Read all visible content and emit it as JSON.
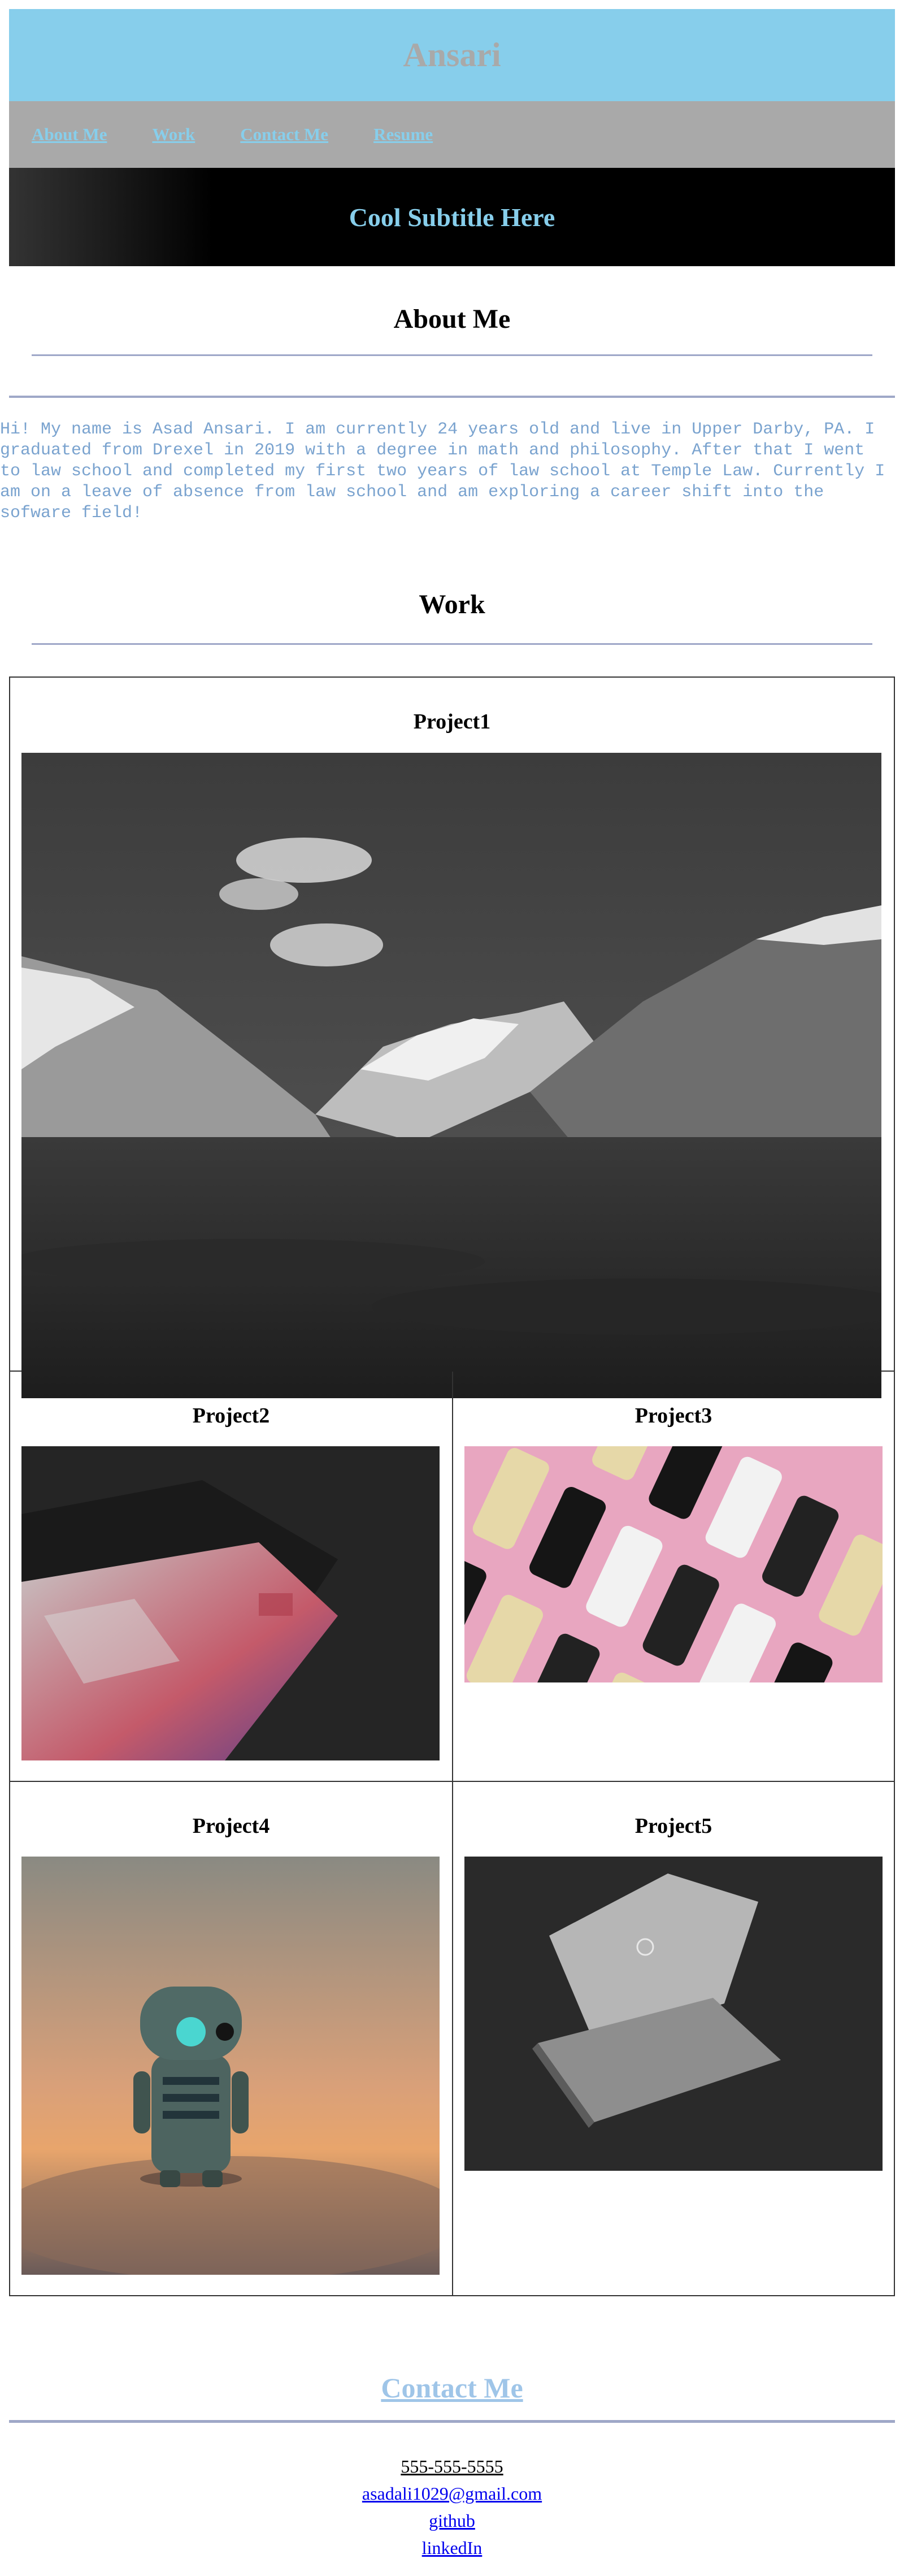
{
  "header": {
    "title": "Ansari"
  },
  "nav": {
    "items": [
      {
        "label": "About Me"
      },
      {
        "label": "Work"
      },
      {
        "label": "Contact Me"
      },
      {
        "label": "Resume"
      }
    ]
  },
  "hero": {
    "subtitle": "Cool Subtitle Here"
  },
  "about": {
    "heading": "About Me",
    "text": "Hi! My name is Asad Ansari. I am currently 24 years old and live in Upper Darby, PA. I graduated from Drexel in 2019 with a degree in math and philosophy. After that I went to law school and completed my first two years of law school at Temple Law. Currently I am on a leave of absence from law school and am exploring a career shift into the sofware field!"
  },
  "work": {
    "heading": "Work",
    "projects": [
      {
        "title": "Project1",
        "image": "mountain-landscape"
      },
      {
        "title": "Project2",
        "image": "laptop-corner"
      },
      {
        "title": "Project3",
        "image": "phones-on-pink"
      },
      {
        "title": "Project4",
        "image": "robot-figure"
      },
      {
        "title": "Project5",
        "image": "laptop-underside"
      }
    ]
  },
  "contact": {
    "heading": "Contact Me",
    "phone": "555-555-5555",
    "email": "asadali1029@gmail.com",
    "github": "github",
    "linkedin": "linkedIn"
  }
}
